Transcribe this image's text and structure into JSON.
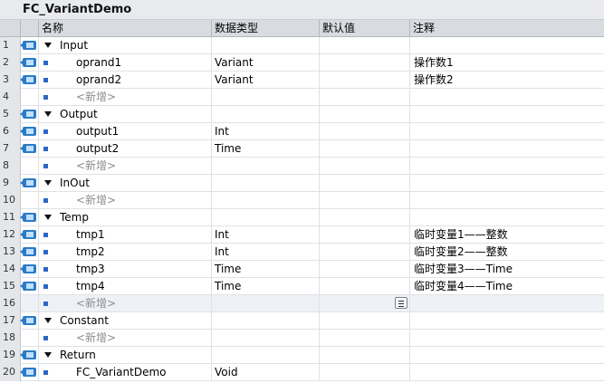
{
  "block": {
    "title": "FC_VariantDemo"
  },
  "columns": {
    "name": "名称",
    "datatype": "数据类型",
    "default": "默认值",
    "comment": "注释"
  },
  "rows": [
    {
      "num": "1",
      "kind": "cat",
      "name": "Input",
      "type": "",
      "comment": ""
    },
    {
      "num": "2",
      "kind": "item",
      "name": "oprand1",
      "type": "Variant",
      "comment": "操作数1"
    },
    {
      "num": "3",
      "kind": "item",
      "name": "oprand2",
      "type": "Variant",
      "comment": "操作数2"
    },
    {
      "num": "4",
      "kind": "add",
      "name": "<新增>",
      "type": "",
      "comment": ""
    },
    {
      "num": "5",
      "kind": "cat",
      "name": "Output",
      "type": "",
      "comment": ""
    },
    {
      "num": "6",
      "kind": "item",
      "name": "output1",
      "type": "Int",
      "comment": ""
    },
    {
      "num": "7",
      "kind": "item",
      "name": "output2",
      "type": "Time",
      "comment": ""
    },
    {
      "num": "8",
      "kind": "add",
      "name": "<新增>",
      "type": "",
      "comment": ""
    },
    {
      "num": "9",
      "kind": "cat",
      "name": "InOut",
      "type": "",
      "comment": ""
    },
    {
      "num": "10",
      "kind": "add",
      "name": "<新增>",
      "type": "",
      "comment": ""
    },
    {
      "num": "11",
      "kind": "cat",
      "name": "Temp",
      "type": "",
      "comment": ""
    },
    {
      "num": "12",
      "kind": "item",
      "name": "tmp1",
      "type": "Int",
      "comment": "临时变量1——整数"
    },
    {
      "num": "13",
      "kind": "item",
      "name": "tmp2",
      "type": "Int",
      "comment": "临时变量2——整数"
    },
    {
      "num": "14",
      "kind": "item",
      "name": "tmp3",
      "type": "Time",
      "comment": "临时变量3——Time"
    },
    {
      "num": "15",
      "kind": "item",
      "name": "tmp4",
      "type": "Time",
      "comment": "临时变量4——Time"
    },
    {
      "num": "16",
      "kind": "add",
      "name": "<新增>",
      "type": "",
      "comment": "",
      "selected": true
    },
    {
      "num": "17",
      "kind": "cat",
      "name": "Constant",
      "type": "",
      "comment": ""
    },
    {
      "num": "18",
      "kind": "add",
      "name": "<新增>",
      "type": "",
      "comment": ""
    },
    {
      "num": "19",
      "kind": "cat",
      "name": "Return",
      "type": "",
      "comment": ""
    },
    {
      "num": "20",
      "kind": "item",
      "name": "FC_VariantDemo",
      "type": "Void",
      "comment": ""
    }
  ]
}
